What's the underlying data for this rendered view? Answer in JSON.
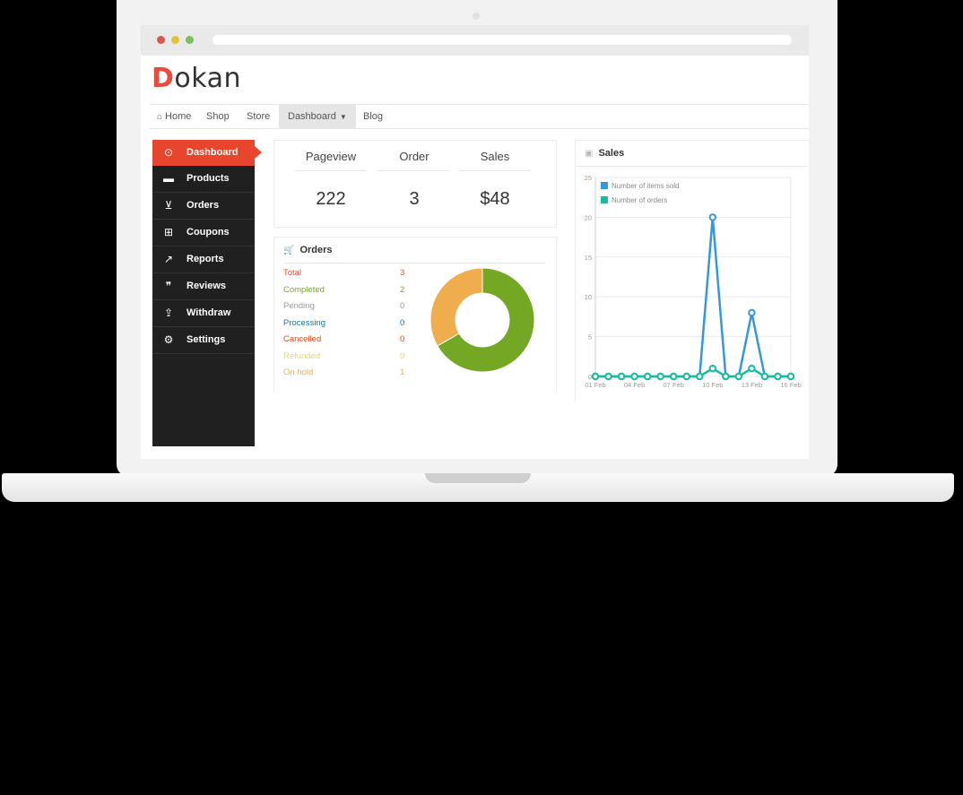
{
  "app": {
    "logo_initial": "D",
    "logo_rest": "okan"
  },
  "topnav": {
    "home_icon": "home-icon",
    "items": [
      {
        "label": "Home"
      },
      {
        "label": "Shop"
      },
      {
        "label": "Store"
      },
      {
        "label": "Dashboard",
        "active": true,
        "has_dropdown": true
      },
      {
        "label": "Blog"
      }
    ]
  },
  "sidebar": {
    "active_color": "#e8452f",
    "items": [
      {
        "label": "Dashboard",
        "icon": "dashboard-icon",
        "glyph": "⊙",
        "active": true
      },
      {
        "label": "Products",
        "icon": "briefcase-icon",
        "glyph": "▬"
      },
      {
        "label": "Orders",
        "icon": "basket-icon",
        "glyph": "⊻"
      },
      {
        "label": "Coupons",
        "icon": "gift-icon",
        "glyph": "⊞"
      },
      {
        "label": "Reports",
        "icon": "line-chart-icon",
        "glyph": "↗"
      },
      {
        "label": "Reviews",
        "icon": "comments-icon",
        "glyph": "❞"
      },
      {
        "label": "Withdraw",
        "icon": "upload-icon",
        "glyph": "⇪"
      },
      {
        "label": "Settings",
        "icon": "gear-icon",
        "glyph": "⚙"
      }
    ]
  },
  "stats": [
    {
      "label": "Pageview",
      "value": "222"
    },
    {
      "label": "Order",
      "value": "3"
    },
    {
      "label": "Sales",
      "value": "$48"
    }
  ],
  "orders": {
    "title": "Orders",
    "icon": "cart-icon",
    "rows": [
      {
        "label": "Total",
        "value": "3",
        "color": "#e74c3c"
      },
      {
        "label": "Completed",
        "value": "2",
        "color": "#73a724"
      },
      {
        "label": "Pending",
        "value": "0",
        "color": "#999999"
      },
      {
        "label": "Processing",
        "value": "0",
        "color": "#21759b"
      },
      {
        "label": "Cancelled",
        "value": "0",
        "color": "#d54e21"
      },
      {
        "label": "Refunded",
        "value": "0",
        "color": "#e6db55"
      },
      {
        "label": "On hold",
        "value": "1",
        "color": "#f0ad4e"
      }
    ]
  },
  "chart_data": [
    {
      "type": "pie",
      "title": "",
      "donut": true,
      "categories": [
        "Completed",
        "On hold"
      ],
      "values": [
        2,
        1
      ],
      "colors": [
        "#73a724",
        "#f0ad4e"
      ]
    },
    {
      "type": "line",
      "title": "Sales",
      "xlabel": "",
      "ylabel": "",
      "ylim": [
        0,
        25
      ],
      "yticks": [
        "0",
        "5",
        "10",
        "15",
        "20",
        "25"
      ],
      "x": [
        "01 Feb",
        "02 Feb",
        "03 Feb",
        "04 Feb",
        "05 Feb",
        "06 Feb",
        "07 Feb",
        "08 Feb",
        "09 Feb",
        "10 Feb",
        "11 Feb",
        "12 Feb",
        "13 Feb",
        "14 Feb",
        "15 Feb",
        "16 Feb"
      ],
      "xtick_labels": [
        "01 Feb",
        "04 Feb",
        "07 Feb",
        "10 Feb",
        "13 Feb",
        "16 Feb"
      ],
      "grid": true,
      "legend_position": "top-left",
      "series": [
        {
          "name": "Number of items sold",
          "color": "#3498db",
          "values": [
            0,
            0,
            0,
            0,
            0,
            0,
            0,
            0,
            0,
            20,
            0,
            0,
            8,
            0,
            0,
            0
          ]
        },
        {
          "name": "Number of orders",
          "color": "#1abc9c",
          "values": [
            0,
            0,
            0,
            0,
            0,
            0,
            0,
            0,
            0,
            1,
            0,
            0,
            1,
            0,
            0,
            0
          ]
        }
      ]
    }
  ]
}
